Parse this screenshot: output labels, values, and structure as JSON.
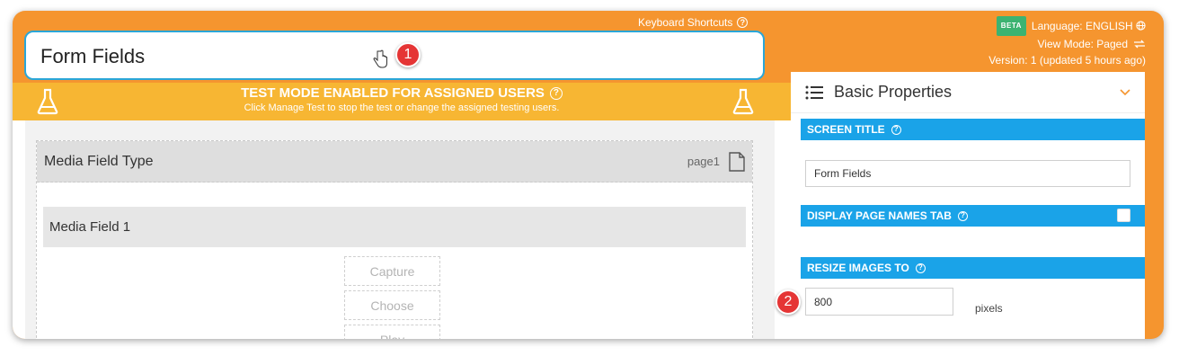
{
  "header": {
    "keyboard_shortcuts": "Keyboard Shortcuts",
    "beta_badge": "BETA",
    "language": "Language: ENGLISH",
    "view_mode": "View Mode: Paged",
    "version": "Version: 1 (updated 5 hours ago)"
  },
  "title_input": {
    "value": "Form Fields"
  },
  "callouts": {
    "first": "1",
    "second": "2"
  },
  "banner": {
    "title": "TEST MODE ENABLED FOR ASSIGNED USERS",
    "subtitle": "Click Manage Test to stop the test or change the assigned testing users."
  },
  "canvas": {
    "page_title": "Media Field Type",
    "page_name": "page1",
    "field_label": "Media Field 1",
    "buttons": [
      "Capture",
      "Choose",
      "Play"
    ]
  },
  "panel": {
    "title": "Basic Properties",
    "screen_title_label": "SCREEN TITLE",
    "screen_title_value": "Form Fields",
    "display_page_names_label": "DISPLAY PAGE NAMES TAB",
    "display_page_names_checked": false,
    "resize_images_label": "RESIZE IMAGES TO",
    "resize_images_value": "800",
    "resize_images_unit": "pixels"
  },
  "colors": {
    "accent_orange": "#f5952f",
    "banner_yellow": "#f7b633",
    "section_blue": "#1aa3e8",
    "callout_red": "#e53535",
    "beta_green": "#3cb371"
  }
}
